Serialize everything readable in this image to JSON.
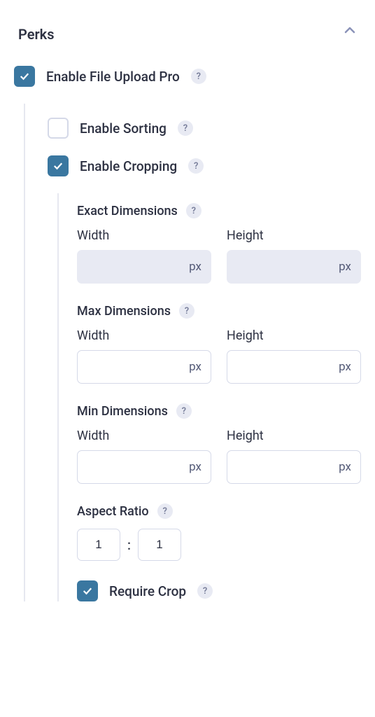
{
  "section": {
    "title": "Perks"
  },
  "main": {
    "label": "Enable File Upload Pro",
    "help": "?"
  },
  "sorting": {
    "label": "Enable Sorting",
    "help": "?"
  },
  "cropping": {
    "label": "Enable Cropping",
    "help": "?"
  },
  "exact": {
    "title": "Exact Dimensions",
    "help": "?",
    "width_label": "Width",
    "height_label": "Height",
    "unit": "px",
    "width_value": "",
    "height_value": ""
  },
  "max": {
    "title": "Max Dimensions",
    "help": "?",
    "width_label": "Width",
    "height_label": "Height",
    "unit": "px",
    "width_value": "",
    "height_value": ""
  },
  "min": {
    "title": "Min Dimensions",
    "help": "?",
    "width_label": "Width",
    "height_label": "Height",
    "unit": "px",
    "width_value": "",
    "height_value": ""
  },
  "aspect": {
    "title": "Aspect Ratio",
    "help": "?",
    "w": "1",
    "h": "1",
    "sep": ":"
  },
  "require_crop": {
    "label": "Require Crop",
    "help": "?"
  }
}
